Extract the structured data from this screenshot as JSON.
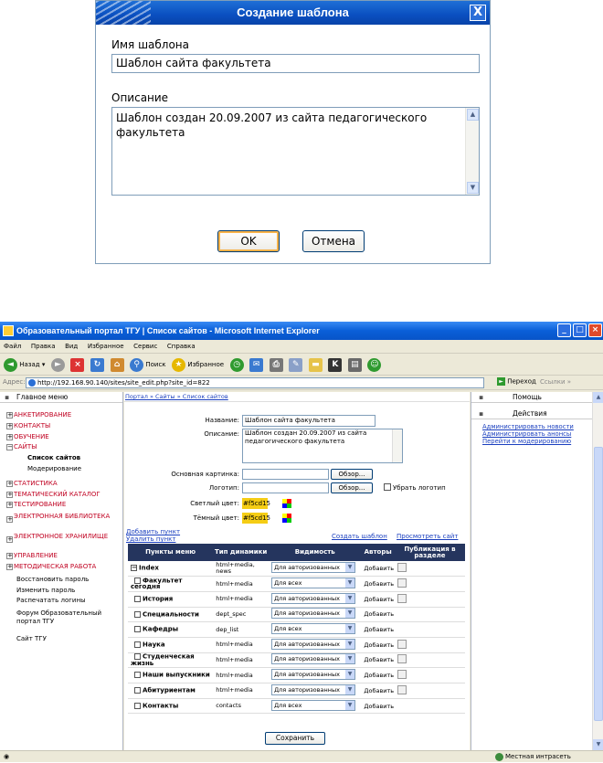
{
  "dialog": {
    "title": "Создание шаблона",
    "close": "X",
    "name_label": "Имя шаблона",
    "name_value": "Шаблон сайта факультета",
    "desc_label": "Описание",
    "desc_value": "Шаблон создан 20.09.2007 из сайта педагогического факультета",
    "ok": "OK",
    "cancel": "Отмена"
  },
  "browser": {
    "title": "Образовательный портал ТГУ | Список сайтов - Microsoft Internet Explorer",
    "menu": [
      "Файл",
      "Правка",
      "Вид",
      "Избранное",
      "Сервис",
      "Справка"
    ],
    "toolbar": {
      "back": "Назад",
      "search": "Поиск",
      "favorites": "Избранное"
    },
    "address_label": "Адрес:",
    "address": "http://192.168.90.140/sites/site_edit.php?site_id=822",
    "go": "Переход",
    "links": "Ссылки",
    "status": "Местная интрасеть"
  },
  "left": {
    "header": "Главное меню",
    "items": [
      {
        "label": "АНКЕТИРОВАНИЕ",
        "mark": "+"
      },
      {
        "label": "КОНТАКТЫ",
        "mark": "+"
      },
      {
        "label": "ОБУЧЕНИЕ",
        "mark": "+"
      },
      {
        "label": "САЙТЫ",
        "mark": "−"
      }
    ],
    "sub": [
      "Список сайтов",
      "Модерирование"
    ],
    "items2": [
      {
        "label": "СТАТИСТИКА",
        "mark": "+"
      },
      {
        "label": "ТЕМАТИЧЕСКИЙ КАТАЛОГ",
        "mark": "+"
      },
      {
        "label": "ТЕСТИРОВАНИЕ",
        "mark": "+"
      },
      {
        "label": "ЭЛЕКТРОННАЯ БИБЛИОТЕКА",
        "mark": "+"
      },
      {
        "label": "ЭЛЕКТРОННОЕ ХРАНИЛИЩЕ",
        "mark": "+"
      },
      {
        "label": "УПРАВЛЕНИЕ",
        "mark": "+"
      },
      {
        "label": "МЕТОДИЧЕСКАЯ РАБОТА",
        "mark": "+"
      }
    ],
    "plain": [
      "Восстановить пароль",
      "Изменить пароль",
      "Распечатать логины",
      "Форум Образовательный портал ТГУ",
      "Сайт ТГУ"
    ]
  },
  "center": {
    "breadcrumb": "Портал » Сайты » Список сайтов",
    "name_label": "Название:",
    "name_value": "Шаблон сайта факультета",
    "desc_label": "Описание:",
    "desc_value": "Шаблон создан 20.09.2007 из сайта педагогического факультета",
    "main_image_label": "Основная картинка:",
    "logo_label": "Логотип:",
    "browse": "Обзор...",
    "remove_logo": "Убрать логотип",
    "light_color_label": "Светлый цвет:",
    "light_color": "#f5cd15",
    "dark_color_label": "Тёмный цвет:",
    "dark_color": "#f5cd15",
    "add_item": "Добавить пункт",
    "delete_item": "Удалить пункт",
    "create_template": "Создать шаблон",
    "view_site": "Просмотреть сайт",
    "table": {
      "headers": [
        "Пункты меню",
        "Тип динамики",
        "Видимость",
        "Авторы",
        "Публикация в разделе"
      ],
      "rows": [
        {
          "name": "Index",
          "type": "html+media, news",
          "vis": "Для авторизованных",
          "auth": "Добавить",
          "pub": true,
          "mark": "−"
        },
        {
          "name": "Факультет сегодня",
          "type": "html+media",
          "vis": "Для всех",
          "auth": "Добавить",
          "pub": true
        },
        {
          "name": "История",
          "type": "html+media",
          "vis": "Для авторизованных",
          "auth": "Добавить",
          "pub": true
        },
        {
          "name": "Специальности",
          "type": "dept_spec",
          "vis": "Для авторизованных",
          "auth": "Добавить",
          "pub": false
        },
        {
          "name": "Кафедры",
          "type": "dep_list",
          "vis": "Для всех",
          "auth": "Добавить",
          "pub": false
        },
        {
          "name": "Наука",
          "type": "html+media",
          "vis": "Для авторизованных",
          "auth": "Добавить",
          "pub": true
        },
        {
          "name": "Студенческая жизнь",
          "type": "html+media",
          "vis": "Для авторизованных",
          "auth": "Добавить",
          "pub": true
        },
        {
          "name": "Наши выпускники",
          "type": "html+media",
          "vis": "Для авторизованных",
          "auth": "Добавить",
          "pub": true
        },
        {
          "name": "Абитуриентам",
          "type": "html+media",
          "vis": "Для авторизованных",
          "auth": "Добавить",
          "pub": true
        },
        {
          "name": "Контакты",
          "type": "contacts",
          "vis": "Для всех",
          "auth": "Добавить",
          "pub": false
        }
      ]
    },
    "save": "Сохранить"
  },
  "right": {
    "help": "Помощь",
    "actions": "Действия",
    "links": [
      "Администрировать новости",
      "Администрировать анонсы",
      "Перейти к модерированию"
    ]
  }
}
